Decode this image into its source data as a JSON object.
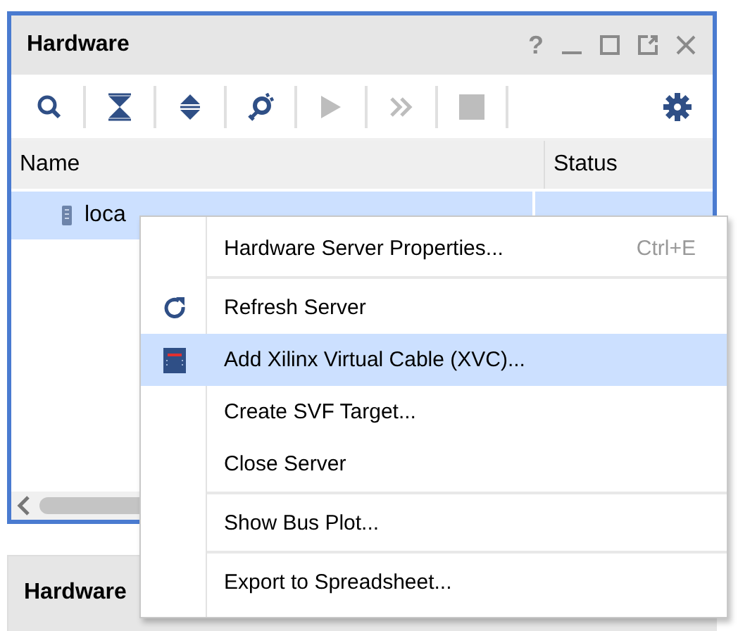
{
  "panel": {
    "title": "Hardware",
    "window_controls": [
      {
        "kind": "help",
        "glyph": "?"
      },
      {
        "kind": "minimize"
      },
      {
        "kind": "maximize"
      },
      {
        "kind": "float"
      },
      {
        "kind": "close"
      }
    ],
    "toolbar": [
      {
        "kind": "search",
        "disabled": false
      },
      {
        "kind": "collapse",
        "disabled": false
      },
      {
        "kind": "expand",
        "disabled": false
      },
      {
        "kind": "connect",
        "disabled": false
      },
      {
        "kind": "run",
        "disabled": true
      },
      {
        "kind": "fast",
        "disabled": true
      },
      {
        "kind": "stop",
        "disabled": true
      },
      {
        "kind": "settings",
        "disabled": false
      }
    ],
    "columns": [
      "Name",
      "Status"
    ],
    "rows": [
      {
        "name": "loca",
        "selected": true
      }
    ]
  },
  "context_menu": [
    {
      "kind": "plain",
      "label": "Hardware Server Properties...",
      "shortcut": "Ctrl+E",
      "selected": false
    },
    {
      "kind": "separator"
    },
    {
      "kind": "refresh",
      "label": "Refresh Server",
      "selected": false
    },
    {
      "kind": "cable",
      "label": "Add Xilinx Virtual Cable (XVC)...",
      "selected": true
    },
    {
      "kind": "plain",
      "label": "Create SVF Target...",
      "selected": false
    },
    {
      "kind": "plain",
      "label": "Close Server",
      "selected": false
    },
    {
      "kind": "separator"
    },
    {
      "kind": "plain",
      "label": "Show Bus Plot...",
      "selected": false
    },
    {
      "kind": "separator"
    },
    {
      "kind": "plain",
      "label": "Export to Spreadsheet...",
      "selected": false
    }
  ],
  "lower_panel": {
    "title": "Hardware"
  }
}
